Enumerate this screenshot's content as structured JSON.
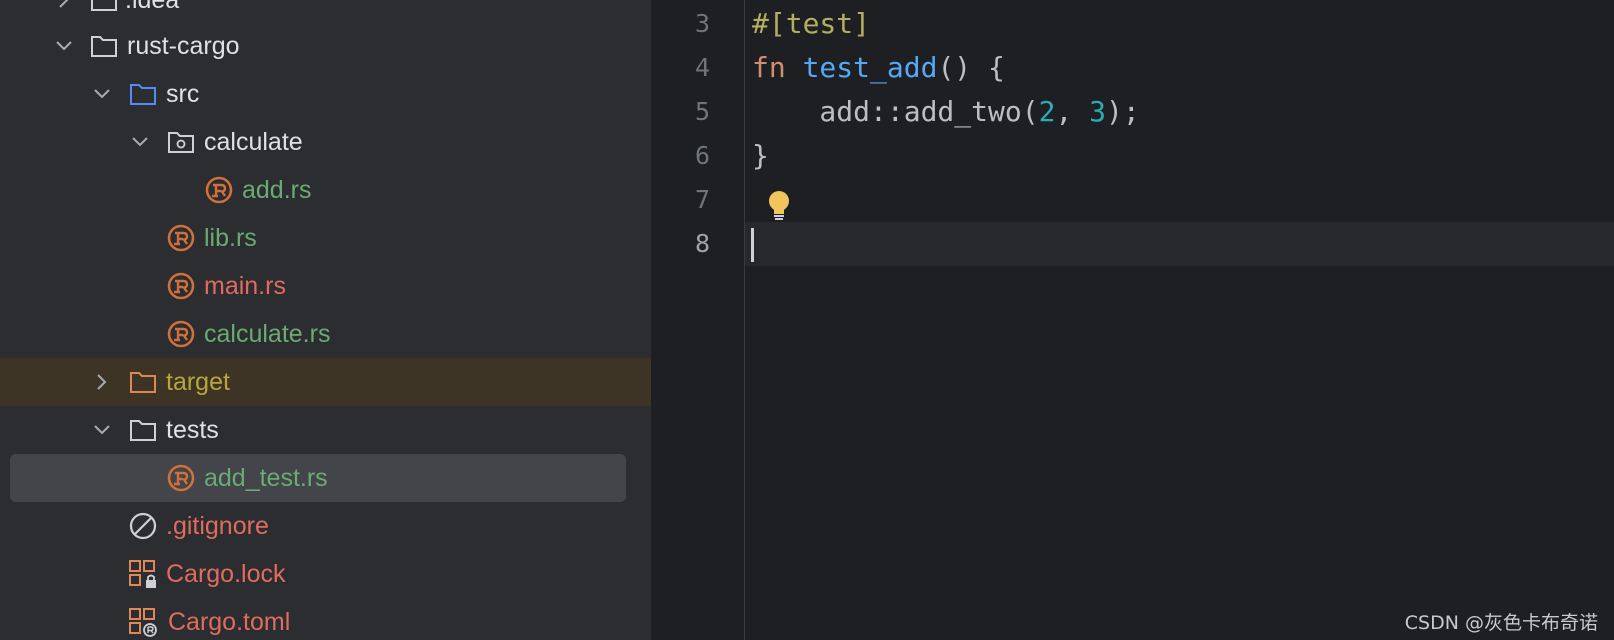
{
  "tree": {
    "items": [
      {
        "label": ".idea"
      },
      {
        "label": "rust-cargo"
      },
      {
        "label": "src"
      },
      {
        "label": "calculate"
      },
      {
        "label": "add.rs"
      },
      {
        "label": "lib.rs"
      },
      {
        "label": "main.rs"
      },
      {
        "label": "calculate.rs"
      },
      {
        "label": "target"
      },
      {
        "label": "tests"
      },
      {
        "label": "add_test.rs"
      },
      {
        "label": ".gitignore"
      },
      {
        "label": "Cargo.lock"
      },
      {
        "label": "Cargo.toml"
      }
    ]
  },
  "editor": {
    "line_numbers": [
      "3",
      "4",
      "5",
      "6",
      "7",
      "8"
    ],
    "lines": {
      "l3": {
        "attr": "#[test]"
      },
      "l4": {
        "kw": "fn",
        "name": "test_add",
        "rest": "() {"
      },
      "l5": {
        "pre": "    add::add_two(",
        "n1": "2",
        "mid": ", ",
        "n2": "3",
        "post": ");"
      },
      "l6": {
        "text": "}"
      }
    },
    "current_line": "8",
    "intention_icon": "lightbulb-icon"
  },
  "colors": {
    "tree_bg": "#2b2d30",
    "editor_bg": "#1e1f22",
    "keyword": "#cf8e6d",
    "function": "#56a8f5",
    "number": "#2aacb8",
    "attribute": "#b3ae60",
    "rust_icon": "#d0703a"
  },
  "watermark": "CSDN @灰色卡布奇诺"
}
